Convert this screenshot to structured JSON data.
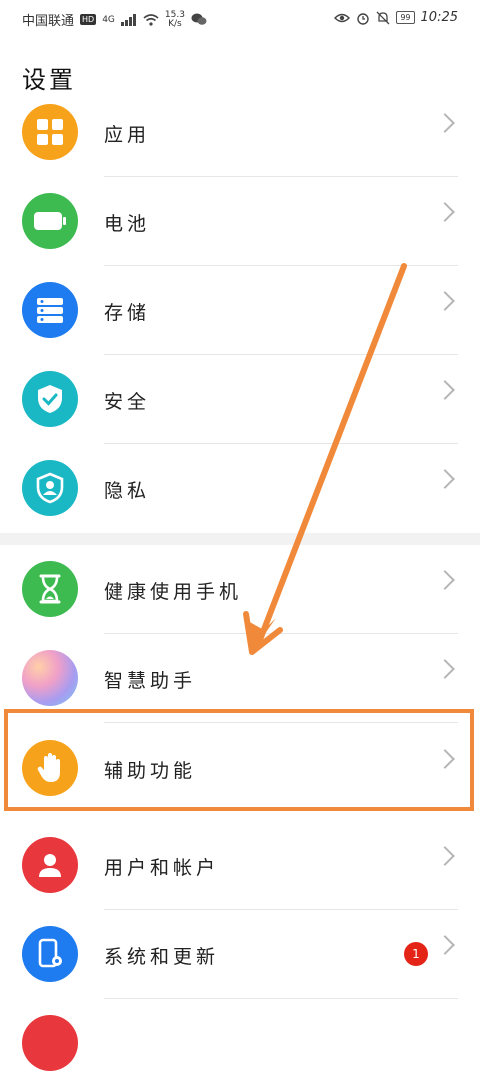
{
  "statusbar": {
    "carrier": "中国联通",
    "hd": "HD",
    "network": "4G",
    "speed_top": "15.3",
    "speed_bottom": "K/s",
    "battery": "99",
    "time": "10:25"
  },
  "page_title": "设置",
  "items": [
    {
      "label": "应用",
      "icon": "apps-icon",
      "color": "#f7a21b"
    },
    {
      "label": "电池",
      "icon": "battery-icon",
      "color": "#3dbb51"
    },
    {
      "label": "存储",
      "icon": "storage-icon",
      "color": "#1f7bf0"
    },
    {
      "label": "安全",
      "icon": "shield-check-icon",
      "color": "#1ab8c4"
    },
    {
      "label": "隐私",
      "icon": "privacy-icon",
      "color": "#1ab8c4"
    },
    {
      "label": "健康使用手机",
      "icon": "hourglass-icon",
      "color": "#3dbb51"
    },
    {
      "label": "智慧助手",
      "icon": "assistant-icon",
      "color": "#b58de8"
    },
    {
      "label": "辅助功能",
      "icon": "hand-icon",
      "color": "#f7a21b"
    },
    {
      "label": "用户和帐户",
      "icon": "user-icon",
      "color": "#e8383d"
    },
    {
      "label": "系统和更新",
      "icon": "system-update-icon",
      "color": "#1f7bf0",
      "badge": "1"
    }
  ],
  "colors": {
    "annotation": "#f08a3a",
    "chevron": "#b5b5b5",
    "badge": "#e42417"
  }
}
